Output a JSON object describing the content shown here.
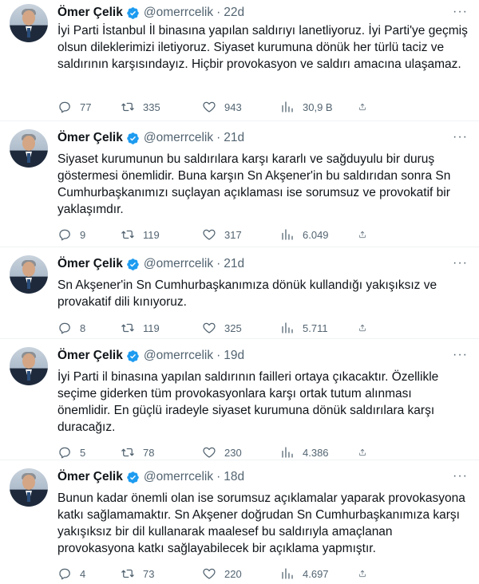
{
  "tweets": [
    {
      "name": "Ömer Çelik",
      "handle": "@omerrcelik",
      "time": "22d",
      "text": "İyi Parti İstanbul İl binasına yapılan saldırıyı lanetliyoruz. İyi Parti'ye geçmiş olsun dileklerimizi iletiyoruz. Siyaset kurumuna dönük her türlü taciz ve saldırının karşısındayız. Hiçbir provokasyon ve saldırı amacına ulaşamaz.",
      "replies": "77",
      "retweets": "335",
      "likes": "943",
      "views": "30,9 B"
    },
    {
      "name": "Ömer Çelik",
      "handle": "@omerrcelik",
      "time": "21d",
      "text": "Siyaset kurumunun bu saldırılara karşı kararlı ve sağduyulu bir duruş göstermesi önemlidir. Buna karşın Sn Akşener'in bu saldırıdan sonra Sn Cumhurbaşkanımızı suçlayan açıklaması ise sorumsuz ve provokatif bir yaklaşımdır.",
      "replies": "9",
      "retweets": "119",
      "likes": "317",
      "views": "6.049"
    },
    {
      "name": "Ömer Çelik",
      "handle": "@omerrcelik",
      "time": "21d",
      "text": "Sn Akşener'in Sn Cumhurbaşkanımıza dönük kullandığı yakışıksız ve provakatif dili kınıyoruz.",
      "replies": "8",
      "retweets": "119",
      "likes": "325",
      "views": "5.711"
    },
    {
      "name": "Ömer Çelik",
      "handle": "@omerrcelik",
      "time": "19d",
      "text": "İyi Parti il binasına yapılan saldırının failleri ortaya çıkacaktır. Özellikle seçime giderken tüm provokasyonlara karşı ortak tutum alınması önemlidir. En güçlü iradeyle siyaset kurumuna dönük saldırılara karşı duracağız.",
      "replies": "5",
      "retweets": "78",
      "likes": "230",
      "views": "4.386"
    },
    {
      "name": "Ömer Çelik",
      "handle": "@omerrcelik",
      "time": "18d",
      "text": "Bunun kadar önemli olan ise sorumsuz açıklamalar yaparak provokasyona katkı sağlamamaktır. Sn Akşener doğrudan Sn Cumhurbaşkanımıza karşı yakışıksız bir dil kullanarak maalesef bu saldırıyla amaçlanan provokasyona katkı sağlayabilecek bir açıklama yapmıştır.",
      "replies": "4",
      "retweets": "73",
      "likes": "220",
      "views": "4.697"
    }
  ],
  "more_label": "···",
  "dot_sep": "·",
  "colors": {
    "verified": "#1d9bf0",
    "secondary_text": "#536471",
    "divider": "#eff3f4"
  }
}
